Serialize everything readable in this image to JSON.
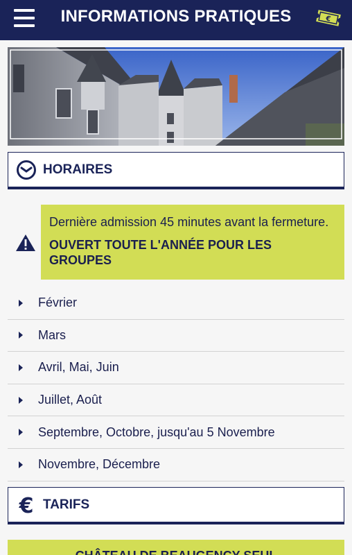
{
  "header": {
    "title": "INFORMATIONS PRATIQUES",
    "menu_icon": "hamburger-menu-icon",
    "ticket_icon": "euro-ticket-icon",
    "ticket_symbol": "€"
  },
  "hero": {
    "image": "château courtyard photo"
  },
  "horaires": {
    "label": "HORAIRES",
    "icon": "clock-icon"
  },
  "notice": {
    "icon": "warning-icon",
    "text": "Dernière admission 45 minutes avant la fermeture.",
    "strong": "OUVERT TOUTE L'ANNÉE POUR LES GROUPES"
  },
  "months": [
    {
      "label": "Février"
    },
    {
      "label": "Mars"
    },
    {
      "label": "Avril, Mai, Juin"
    },
    {
      "label": "Juillet, Août"
    },
    {
      "label": "Septembre, Octobre, jusqu'au 5 Novembre"
    },
    {
      "label": "Novembre, Décembre"
    }
  ],
  "tarifs": {
    "label": "TARIFS",
    "icon": "euro-icon",
    "symbol": "€"
  },
  "banner": {
    "text": "CHÂTEAU DE BEAUGENCY SEUL"
  },
  "colors": {
    "navy": "#1a2358",
    "accent_green": "#d2dd55",
    "background": "#f6f6f6"
  }
}
